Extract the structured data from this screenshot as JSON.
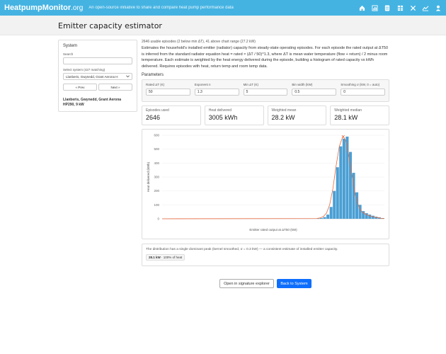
{
  "header": {
    "brand_main": "HeatpumpMonitor",
    "brand_org": ".org",
    "tagline": "An open-source initiative to share and compare heat pump performance data",
    "icons": [
      "home-icon",
      "bar-chart-icon",
      "server-icon",
      "table-icon",
      "tools-icon",
      "line-chart-icon",
      "user-icon"
    ]
  },
  "page": {
    "title": "Emitter capacity estimator"
  },
  "sidebar": {
    "heading": "System",
    "search_label": "Search",
    "search_value": "",
    "select_label": "Select system (427 matching)",
    "select_value": "Llanberis, Gwynedd, Grant Aerona H",
    "prev_label": "« Prev",
    "next_label": "Next »",
    "system_name": "Llanberis, Gwynedd, Grant Aerona HP290, 9 kW"
  },
  "main": {
    "stats_line": "2646 usable episodes (2 below min ΔT), 41 above chart range (27.2 kW)",
    "description": "Estimates the household's installed emitter (radiator) capacity from steady-state operating episodes. For each episode the rated output at ΔT50 is inferred from the standard radiator equation heat = rated × (ΔT / 50)^1.3, where ΔT is mean water temperature (flow + return) / 2 minus room temperature. Each estimate is weighted by the heat energy delivered during the episode, building a histogram of rated capacity vs kWh delivered. Requires episodes with heat, return temp and room temp data.",
    "params_title": "Parameters",
    "params": [
      {
        "label": "Rated ΔT (K)",
        "value": "50"
      },
      {
        "label": "Exponent n",
        "value": "1.3"
      },
      {
        "label": "Min ΔT (K)",
        "value": "5"
      },
      {
        "label": "Bin width (kW)",
        "value": "0.5"
      },
      {
        "label": "Smoothing σ (kW, 0 = auto)",
        "value": "0"
      }
    ],
    "cards": [
      {
        "label": "Episodes used",
        "value": "2646"
      },
      {
        "label": "Heat delivered",
        "value": "3005 kWh"
      },
      {
        "label": "Weighted mean",
        "value": "28.2 kW"
      },
      {
        "label": "Weighted median",
        "value": "28.1 kW"
      }
    ],
    "note": "The distribution has a single dominant peak (kernel smoothed, σ = 0.3 kW) — a consistent estimate of installed emitter capacity.",
    "pill_value": "28.1 kW",
    "pill_text": " · 100% of heat",
    "btn_signature": "Open in signature explorer",
    "btn_back": "Back to System"
  },
  "colors": {
    "topbar": "#44b3e2",
    "bar": "#4a9fd4",
    "curve": "#e8693c",
    "primary": "#0d6efd"
  },
  "chart_data": {
    "type": "bar",
    "title": "",
    "xlabel": "Emitter rated output at ΔT50 (kW)",
    "ylabel": "Heat delivered (kWh)",
    "yticks": [
      0,
      100,
      200,
      300,
      400,
      500,
      600
    ],
    "ylim": [
      0,
      600
    ],
    "xlim": [
      0,
      34.5
    ],
    "bin_width": 0.5,
    "series": [
      {
        "name": "",
        "type": "bar",
        "x": [
          24.0,
          24.5,
          25.0,
          25.5,
          26.0,
          26.5,
          27.0,
          27.5,
          28.0,
          28.5,
          29.0,
          29.5,
          30.0,
          30.5,
          31.0,
          31.5,
          32.0,
          32.5,
          33.0,
          33.5,
          34.0
        ],
        "values": [
          2,
          5,
          12,
          30,
          85,
          200,
          370,
          520,
          575,
          590,
          480,
          330,
          190,
          100,
          55,
          40,
          30,
          22,
          15,
          10,
          5
        ]
      },
      {
        "name": "",
        "type": "line",
        "x": [
          0,
          24,
          24.5,
          25,
          25.5,
          26,
          26.5,
          27,
          27.5,
          28,
          28.1,
          28.5,
          29,
          29.5,
          30,
          30.5,
          31,
          31.5,
          32,
          32.5,
          33,
          33.5,
          34,
          34.5
        ],
        "values": [
          0,
          2,
          6,
          15,
          40,
          100,
          215,
          380,
          520,
          585,
          590,
          560,
          450,
          300,
          170,
          90,
          50,
          35,
          25,
          18,
          12,
          8,
          4,
          2
        ]
      }
    ],
    "peak_marker": {
      "x": 28.1,
      "y": 590
    }
  }
}
